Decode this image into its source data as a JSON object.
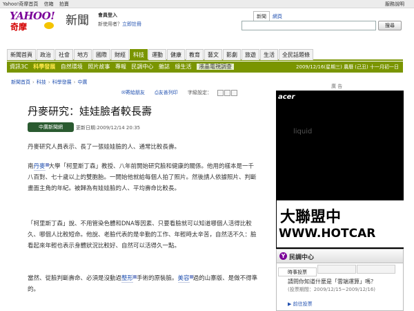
{
  "topbar": {
    "links": [
      "Yahoo!奇摩首頁",
      "信箱",
      "拍賣"
    ],
    "help": "服務說明"
  },
  "logo": {
    "brand": "YAHOO!",
    "sub": "奇摩"
  },
  "section_title": "新聞",
  "login": {
    "title": "會員登入",
    "prompt": "新使用者？",
    "register": "立即註冊"
  },
  "search": {
    "tabs": [
      "新聞",
      "網頁"
    ],
    "active_tab": 0,
    "value": "",
    "button": "搜尋"
  },
  "nav": {
    "items": [
      "新聞首頁",
      "政治",
      "社會",
      "地方",
      "國際",
      "財經",
      "科技",
      "運動",
      "健康",
      "教育",
      "藝文",
      "影劇",
      "旅遊",
      "生活",
      "全民話題條"
    ],
    "active": 6
  },
  "subnav": {
    "items": [
      "資訊3C",
      "科學發展",
      "自然環境",
      "照片故事",
      "專報",
      "民調中心",
      "雜誌",
      "綠生活",
      "液晶電視調查"
    ],
    "active": 1,
    "date": "2009/12/16(星期三) 農曆 (己丑) 十一月初一日"
  },
  "breadcrumb": [
    "新聞首頁",
    "科技",
    "科學發展",
    "中廣"
  ],
  "tools": {
    "send": "寄給朋友",
    "print": "友善列印",
    "font_label": "字級設定："
  },
  "article": {
    "title": "丹麥研究：娃娃臉者較長壽",
    "source": "中廣新聞網",
    "updated": "更新日期:2009/12/14 20:35",
    "p1": "丹麥研究人員表示、長了一張娃娃臉的人、通常比較長壽。",
    "p2": {
      "a": "南",
      "link": "丹麥",
      "b": "大學「柯里斯丁森」教授、八年前開始研究臉和健康的關係。他用的樣本是一千八百對、七十歲以上的雙胞胎。一開始他就給每個人拍了照片。然後請人依據照片、判斷畫面主角的年紀。被歸為有娃娃臉的人、平均壽命比較長。"
    },
    "p3": "「柯里斯丁森」說、不用管染色體和DNA等因素、只要看臉就可以知道哪個人活得比較久、哪個人比較短命。他說、老臉代表的是辛勤的工作、年輕時太辛苦，自然活不久：臉看起來年輕也表示身體狀況比較好、自然可以活得久一點。",
    "p4": {
      "a": "當然、從臉判斷壽命、必須是沒動過",
      "link1": "整形",
      "b": "手術的原裝臉。",
      "link2": "美容",
      "c": "過的山寨版、是做不得準的。"
    }
  },
  "ad": {
    "label": "廣 告",
    "brand": "acer",
    "tagline": "liquid",
    "cn": "大聯盟中",
    "en": "WWW.HOTCAR"
  },
  "poll": {
    "title": "民調中心",
    "tabs": [
      "時事投票",
      "",
      ""
    ],
    "question": "請問你知道什麼是「雲端運算」嗎？",
    "period": "(投票期間：2009/12/15~2009/12/16)",
    "link": "前往投票"
  }
}
